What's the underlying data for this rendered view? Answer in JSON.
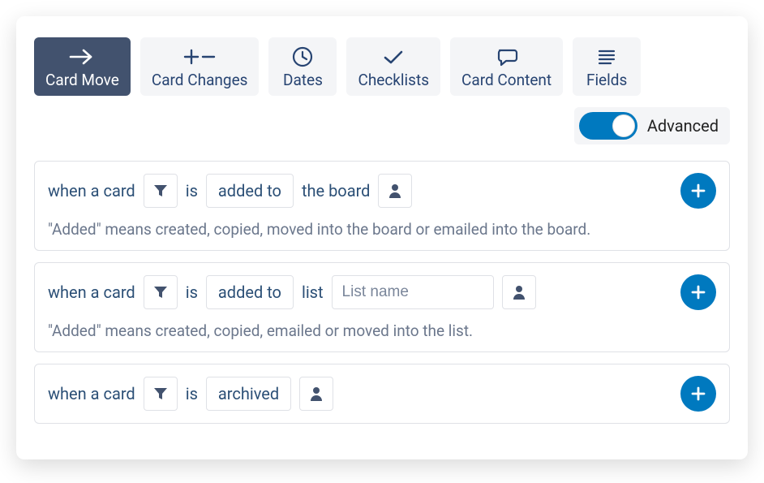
{
  "tabs": {
    "card_move": "Card Move",
    "card_changes": "Card Changes",
    "dates": "Dates",
    "checklists": "Checklists",
    "card_content": "Card Content",
    "fields": "Fields"
  },
  "advanced_label": "Advanced",
  "triggers": [
    {
      "prefix": "when a card",
      "is": "is",
      "action": "added to",
      "suffix": "the board",
      "helper": "\"Added\" means created, copied, moved into the board or emailed into the board."
    },
    {
      "prefix": "when a card",
      "is": "is",
      "action": "added to",
      "list_label": "list",
      "list_placeholder": "List name",
      "helper": "\"Added\" means created, copied, emailed or moved into the list."
    },
    {
      "prefix": "when a card",
      "is": "is",
      "action": "archived"
    }
  ]
}
